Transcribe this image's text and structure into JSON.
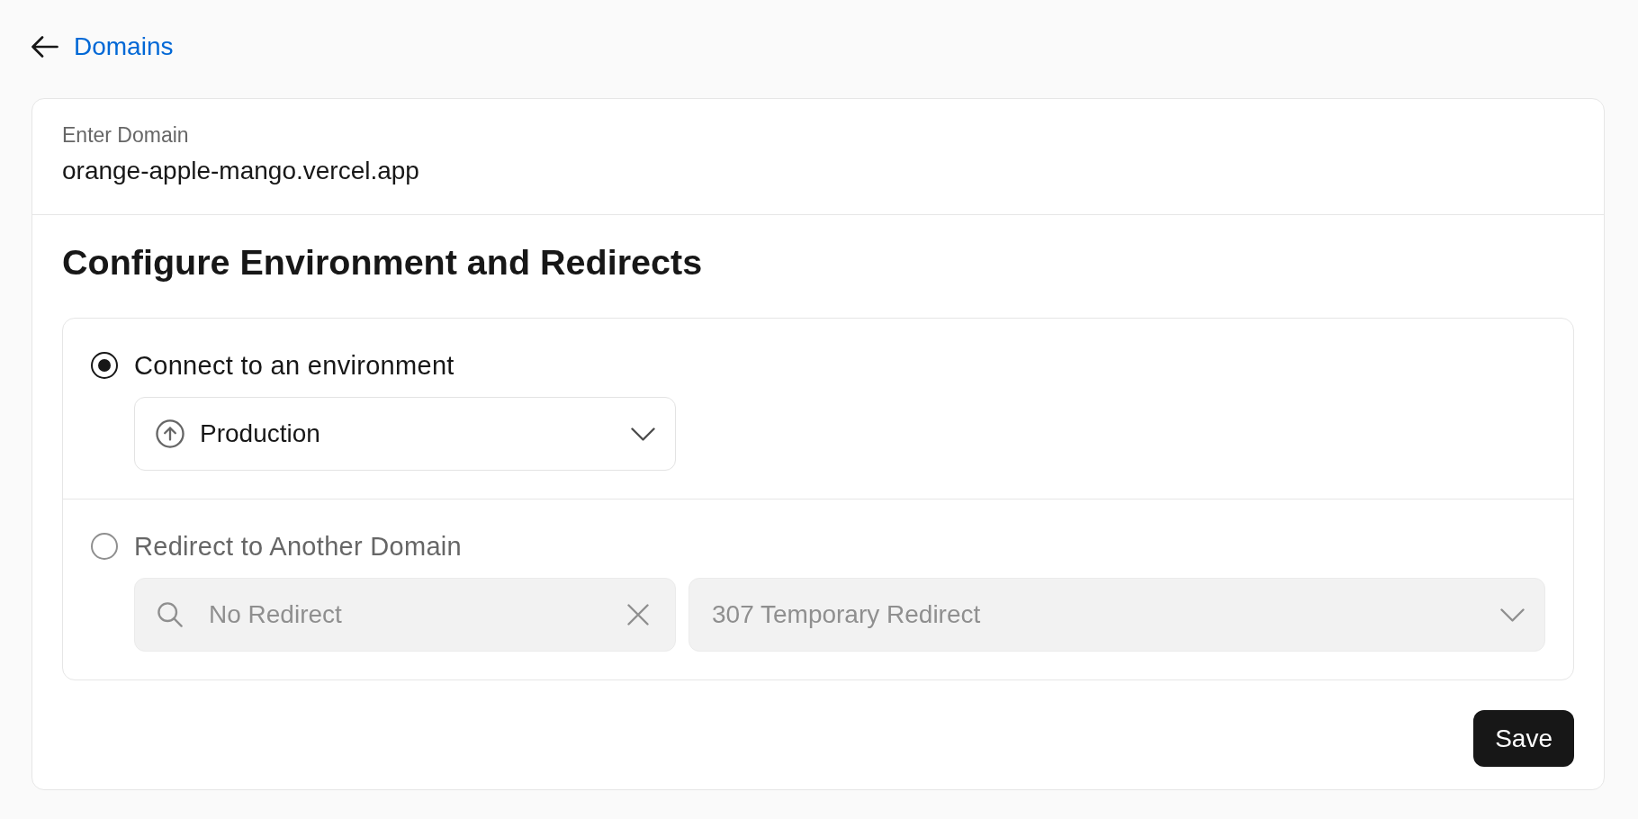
{
  "back_link": {
    "label": "Domains"
  },
  "domain_field": {
    "label": "Enter Domain",
    "value": "orange-apple-mango.vercel.app"
  },
  "config": {
    "title": "Configure Environment and Redirects",
    "options": [
      {
        "kind": "environment",
        "label": "Connect to an environment",
        "selected": true,
        "environment_select": {
          "value": "Production"
        }
      },
      {
        "kind": "redirect",
        "label": "Redirect to Another Domain",
        "selected": false,
        "redirect_search": {
          "placeholder": "No Redirect"
        },
        "status_select": {
          "value": "307 Temporary Redirect"
        }
      }
    ]
  },
  "save_button": {
    "label": "Save"
  }
}
